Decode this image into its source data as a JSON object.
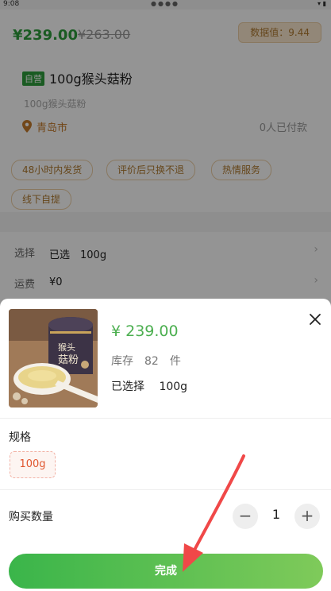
{
  "status_bar": {
    "time": "9:08",
    "dots": "●●●●",
    "icons": "▾ ▮"
  },
  "product": {
    "price": "¥239.00",
    "original_price": "¥263.00",
    "data_value": "数据值：9.44",
    "self_tag": "自营",
    "title": "100g猴头菇粉",
    "subtitle": "100g猴头菇粉",
    "location": "青岛市",
    "paid_count": "0人已付款",
    "tags": [
      "48小时内发货",
      "评价后只换不退",
      "热情服务",
      "线下自提"
    ]
  },
  "options": {
    "select_label": "选择",
    "select_value": "已选　100g",
    "shipping_label": "运费",
    "shipping_value": "¥0"
  },
  "sheet": {
    "price": "¥ 239.00",
    "stock": "库存　82　件",
    "selected": "已选择　 100g",
    "spec_label": "规格",
    "spec_option": "100g",
    "quantity_label": "购买数量",
    "quantity_value": "1",
    "minus": "−",
    "plus": "+",
    "done_label": "完成",
    "jar_label_1": "猴头",
    "jar_label_2": "菇粉"
  },
  "colors": {
    "price_green": "#2e9e3c",
    "sheet_price_green": "#4caf50",
    "spec_accent": "#e0562f",
    "done_gradient_start": "#3ab54a",
    "done_gradient_end": "#7fca5a",
    "arrow_red": "#f04848"
  },
  "icons": [
    "location-pin-icon",
    "chevron-right-icon",
    "close-icon",
    "minus-icon",
    "plus-icon",
    "red-arrow-annotation"
  ]
}
